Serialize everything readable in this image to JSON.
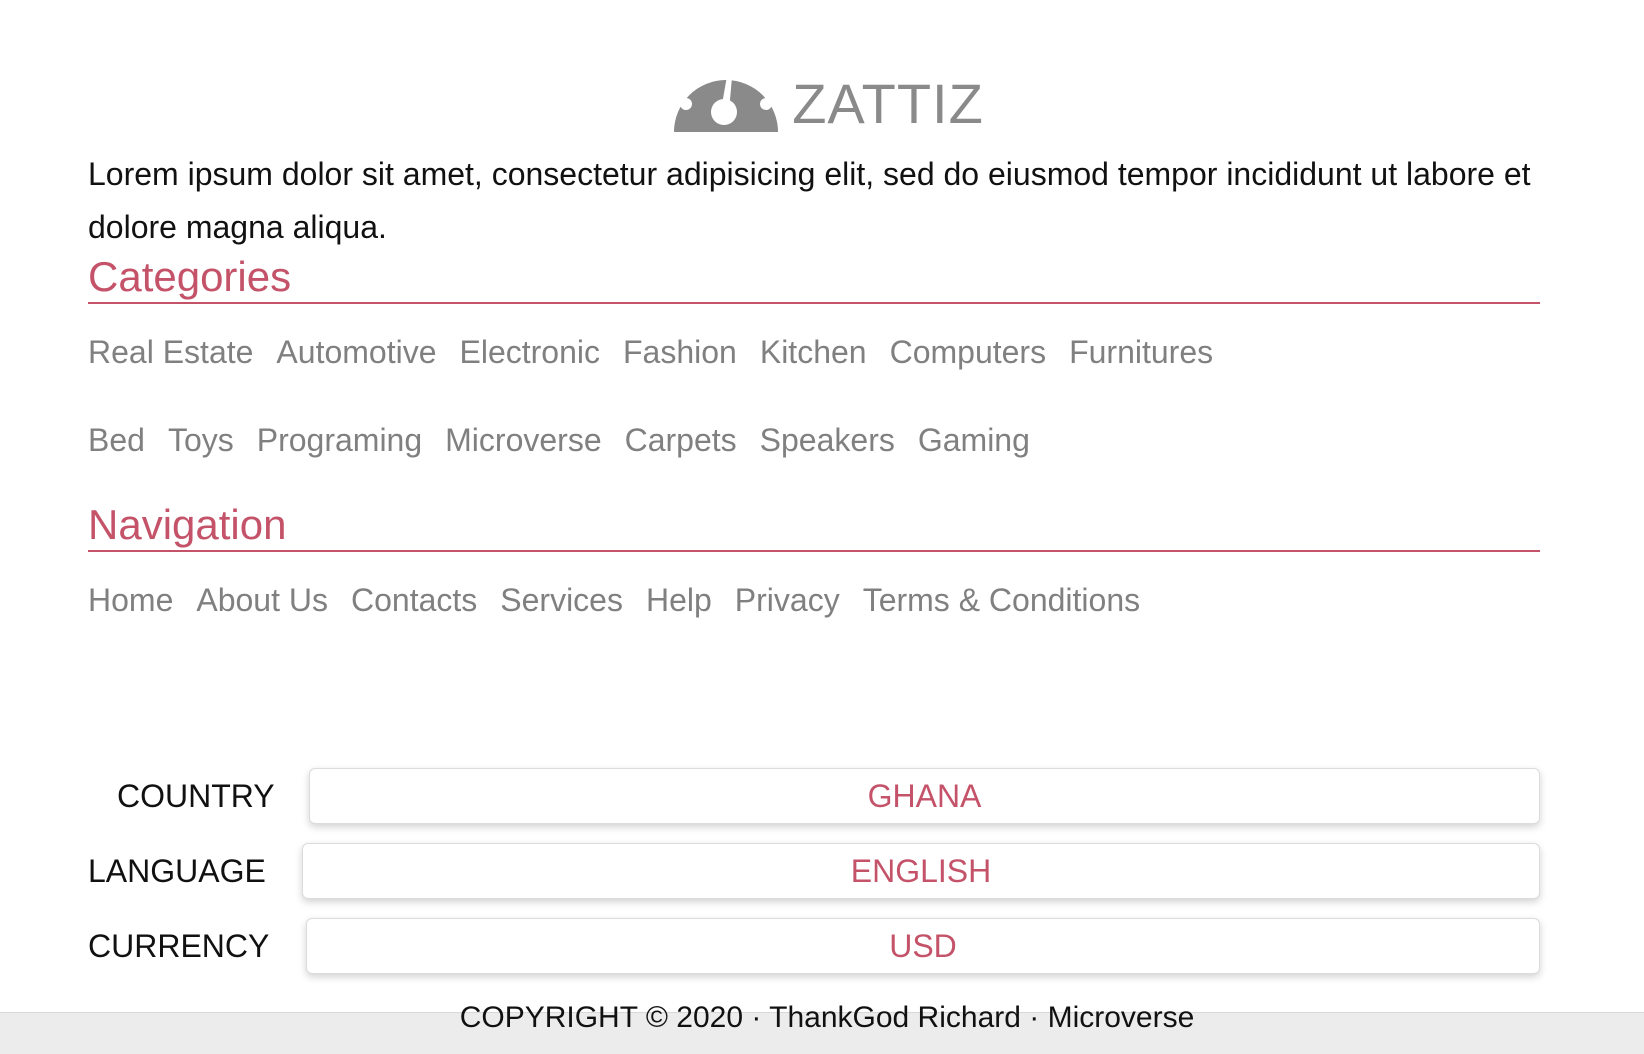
{
  "brand": {
    "name": "ZATTIZ",
    "logo_icon": "dashboard-gauge-icon",
    "color": "#8a8a8a"
  },
  "intro_text": "Lorem ipsum dolor sit amet, consectetur adipisicing elit, sed do eiusmod tempor incididunt ut labore et dolore magna aliqua.",
  "categories": {
    "heading": "Categories",
    "row1": [
      "Real Estate",
      "Automotive",
      "Electronic",
      "Fashion",
      "Kitchen",
      "Computers",
      "Furnitures"
    ],
    "row2": [
      "Bed",
      "Toys",
      "Programing",
      "Microverse",
      "Carpets",
      "Speakers",
      "Gaming"
    ]
  },
  "navigation": {
    "heading": "Navigation",
    "links": [
      "Home",
      "About Us",
      "Contacts",
      "Services",
      "Help",
      "Privacy",
      "Terms & Conditions"
    ]
  },
  "settings": {
    "country": {
      "label": "COUNTRY",
      "value": "GHANA"
    },
    "language": {
      "label": "LANGUAGE",
      "value": "ENGLISH"
    },
    "currency": {
      "label": "CURRENCY",
      "value": "USD"
    }
  },
  "footer": {
    "copyright": "COPYRIGHT © 2020 · ThankGod Richard · Microverse"
  },
  "colors": {
    "accent": "#c4536a",
    "link": "#808080",
    "text": "#111111",
    "footer_bg": "#ececec"
  }
}
